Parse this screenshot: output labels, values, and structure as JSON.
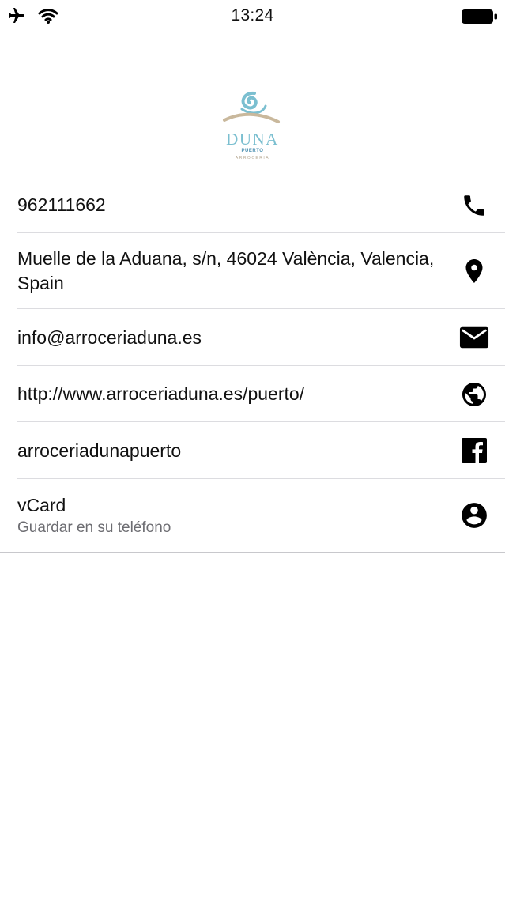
{
  "status_bar": {
    "time": "13:24",
    "icons": [
      "airplane-icon",
      "wifi-icon",
      "battery-icon"
    ]
  },
  "logo": {
    "wordmark": "DUNA",
    "subtitle": "PUERTO",
    "tagline": "ARROCERIA"
  },
  "contact_items": [
    {
      "label": "962111662",
      "icon": "phone-icon"
    },
    {
      "label": "Muelle de la Aduana, s/n, 46024 València, Valencia, Spain",
      "icon": "location-pin-icon"
    },
    {
      "label": "info@arroceriaduna.es",
      "icon": "mail-icon"
    },
    {
      "label": "http://www.arroceriaduna.es/puerto/",
      "icon": "globe-icon"
    },
    {
      "label": "arroceriadunapuerto",
      "icon": "facebook-icon"
    },
    {
      "label": "vCard",
      "sublabel": "Guardar en su teléfono",
      "icon": "contact-card-icon"
    }
  ],
  "colors": {
    "logo_blue": "#7bbfd0",
    "logo_sand": "#c9b89c",
    "separator": "#dcdce0",
    "secondary_text": "#6d6d72"
  }
}
